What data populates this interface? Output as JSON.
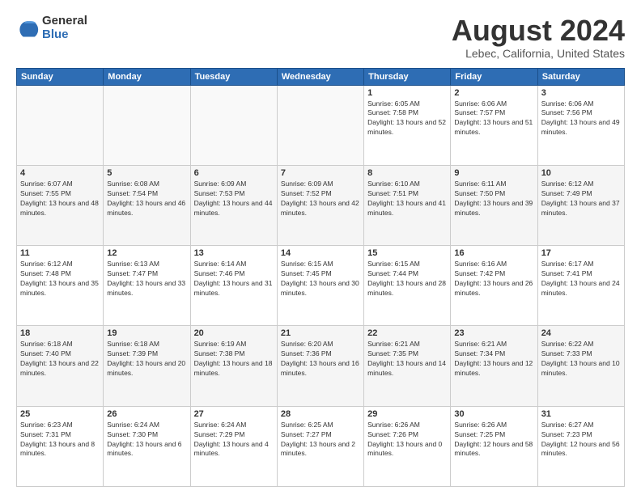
{
  "header": {
    "logo_general": "General",
    "logo_blue": "Blue",
    "title": "August 2024",
    "subtitle": "Lebec, California, United States"
  },
  "days_of_week": [
    "Sunday",
    "Monday",
    "Tuesday",
    "Wednesday",
    "Thursday",
    "Friday",
    "Saturday"
  ],
  "weeks": [
    [
      {
        "day": "",
        "empty": true
      },
      {
        "day": "",
        "empty": true
      },
      {
        "day": "",
        "empty": true
      },
      {
        "day": "",
        "empty": true
      },
      {
        "day": "1",
        "sunrise": "6:05 AM",
        "sunset": "7:58 PM",
        "daylight": "13 hours and 52 minutes."
      },
      {
        "day": "2",
        "sunrise": "6:06 AM",
        "sunset": "7:57 PM",
        "daylight": "13 hours and 51 minutes."
      },
      {
        "day": "3",
        "sunrise": "6:06 AM",
        "sunset": "7:56 PM",
        "daylight": "13 hours and 49 minutes."
      }
    ],
    [
      {
        "day": "4",
        "sunrise": "6:07 AM",
        "sunset": "7:55 PM",
        "daylight": "13 hours and 48 minutes."
      },
      {
        "day": "5",
        "sunrise": "6:08 AM",
        "sunset": "7:54 PM",
        "daylight": "13 hours and 46 minutes."
      },
      {
        "day": "6",
        "sunrise": "6:09 AM",
        "sunset": "7:53 PM",
        "daylight": "13 hours and 44 minutes."
      },
      {
        "day": "7",
        "sunrise": "6:09 AM",
        "sunset": "7:52 PM",
        "daylight": "13 hours and 42 minutes."
      },
      {
        "day": "8",
        "sunrise": "6:10 AM",
        "sunset": "7:51 PM",
        "daylight": "13 hours and 41 minutes."
      },
      {
        "day": "9",
        "sunrise": "6:11 AM",
        "sunset": "7:50 PM",
        "daylight": "13 hours and 39 minutes."
      },
      {
        "day": "10",
        "sunrise": "6:12 AM",
        "sunset": "7:49 PM",
        "daylight": "13 hours and 37 minutes."
      }
    ],
    [
      {
        "day": "11",
        "sunrise": "6:12 AM",
        "sunset": "7:48 PM",
        "daylight": "13 hours and 35 minutes."
      },
      {
        "day": "12",
        "sunrise": "6:13 AM",
        "sunset": "7:47 PM",
        "daylight": "13 hours and 33 minutes."
      },
      {
        "day": "13",
        "sunrise": "6:14 AM",
        "sunset": "7:46 PM",
        "daylight": "13 hours and 31 minutes."
      },
      {
        "day": "14",
        "sunrise": "6:15 AM",
        "sunset": "7:45 PM",
        "daylight": "13 hours and 30 minutes."
      },
      {
        "day": "15",
        "sunrise": "6:15 AM",
        "sunset": "7:44 PM",
        "daylight": "13 hours and 28 minutes."
      },
      {
        "day": "16",
        "sunrise": "6:16 AM",
        "sunset": "7:42 PM",
        "daylight": "13 hours and 26 minutes."
      },
      {
        "day": "17",
        "sunrise": "6:17 AM",
        "sunset": "7:41 PM",
        "daylight": "13 hours and 24 minutes."
      }
    ],
    [
      {
        "day": "18",
        "sunrise": "6:18 AM",
        "sunset": "7:40 PM",
        "daylight": "13 hours and 22 minutes."
      },
      {
        "day": "19",
        "sunrise": "6:18 AM",
        "sunset": "7:39 PM",
        "daylight": "13 hours and 20 minutes."
      },
      {
        "day": "20",
        "sunrise": "6:19 AM",
        "sunset": "7:38 PM",
        "daylight": "13 hours and 18 minutes."
      },
      {
        "day": "21",
        "sunrise": "6:20 AM",
        "sunset": "7:36 PM",
        "daylight": "13 hours and 16 minutes."
      },
      {
        "day": "22",
        "sunrise": "6:21 AM",
        "sunset": "7:35 PM",
        "daylight": "13 hours and 14 minutes."
      },
      {
        "day": "23",
        "sunrise": "6:21 AM",
        "sunset": "7:34 PM",
        "daylight": "13 hours and 12 minutes."
      },
      {
        "day": "24",
        "sunrise": "6:22 AM",
        "sunset": "7:33 PM",
        "daylight": "13 hours and 10 minutes."
      }
    ],
    [
      {
        "day": "25",
        "sunrise": "6:23 AM",
        "sunset": "7:31 PM",
        "daylight": "13 hours and 8 minutes."
      },
      {
        "day": "26",
        "sunrise": "6:24 AM",
        "sunset": "7:30 PM",
        "daylight": "13 hours and 6 minutes."
      },
      {
        "day": "27",
        "sunrise": "6:24 AM",
        "sunset": "7:29 PM",
        "daylight": "13 hours and 4 minutes."
      },
      {
        "day": "28",
        "sunrise": "6:25 AM",
        "sunset": "7:27 PM",
        "daylight": "13 hours and 2 minutes."
      },
      {
        "day": "29",
        "sunrise": "6:26 AM",
        "sunset": "7:26 PM",
        "daylight": "13 hours and 0 minutes."
      },
      {
        "day": "30",
        "sunrise": "6:26 AM",
        "sunset": "7:25 PM",
        "daylight": "12 hours and 58 minutes."
      },
      {
        "day": "31",
        "sunrise": "6:27 AM",
        "sunset": "7:23 PM",
        "daylight": "12 hours and 56 minutes."
      }
    ]
  ],
  "labels": {
    "sunrise": "Sunrise:",
    "sunset": "Sunset:",
    "daylight": "Daylight:"
  }
}
